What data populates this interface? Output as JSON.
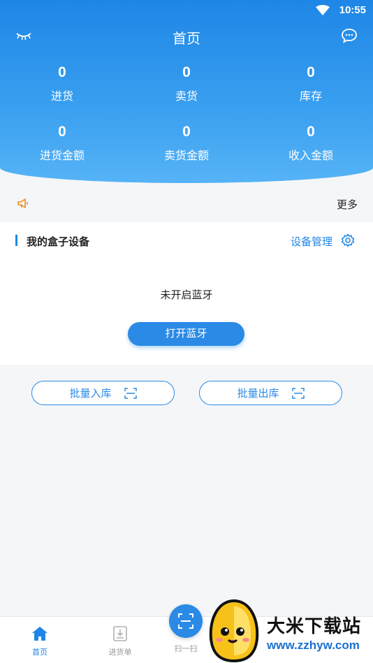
{
  "status_bar": {
    "time": "10:55"
  },
  "header": {
    "title": "首页"
  },
  "stats": [
    {
      "value": "0",
      "label": "进货"
    },
    {
      "value": "0",
      "label": "卖货"
    },
    {
      "value": "0",
      "label": "库存"
    },
    {
      "value": "0",
      "label": "进货金额"
    },
    {
      "value": "0",
      "label": "卖货金额"
    },
    {
      "value": "0",
      "label": "收入金额"
    }
  ],
  "notice": {
    "more_label": "更多"
  },
  "device_card": {
    "title": "我的盒子设备",
    "manage_label": "设备管理",
    "bluetooth_status": "未开启蓝牙",
    "open_bluetooth_label": "打开蓝牙"
  },
  "batch": {
    "in_label": "批量入库",
    "out_label": "批量出库"
  },
  "tabbar": {
    "items": [
      {
        "label": "首页",
        "active": true
      },
      {
        "label": "进货单",
        "active": false
      },
      {
        "label": "扫一扫",
        "active": false
      }
    ]
  },
  "watermark": {
    "title": "大米下载站",
    "url": "www.zzhyw.com"
  },
  "colors": {
    "primary": "#1e86e6",
    "header_light": "#56b3f6",
    "text": "#222222",
    "muted": "#999999"
  },
  "icons": [
    "wifi-icon",
    "eye-closed-icon",
    "chat-icon",
    "megaphone-icon",
    "gear-icon",
    "scan-icon",
    "home-icon",
    "download-list-icon"
  ]
}
